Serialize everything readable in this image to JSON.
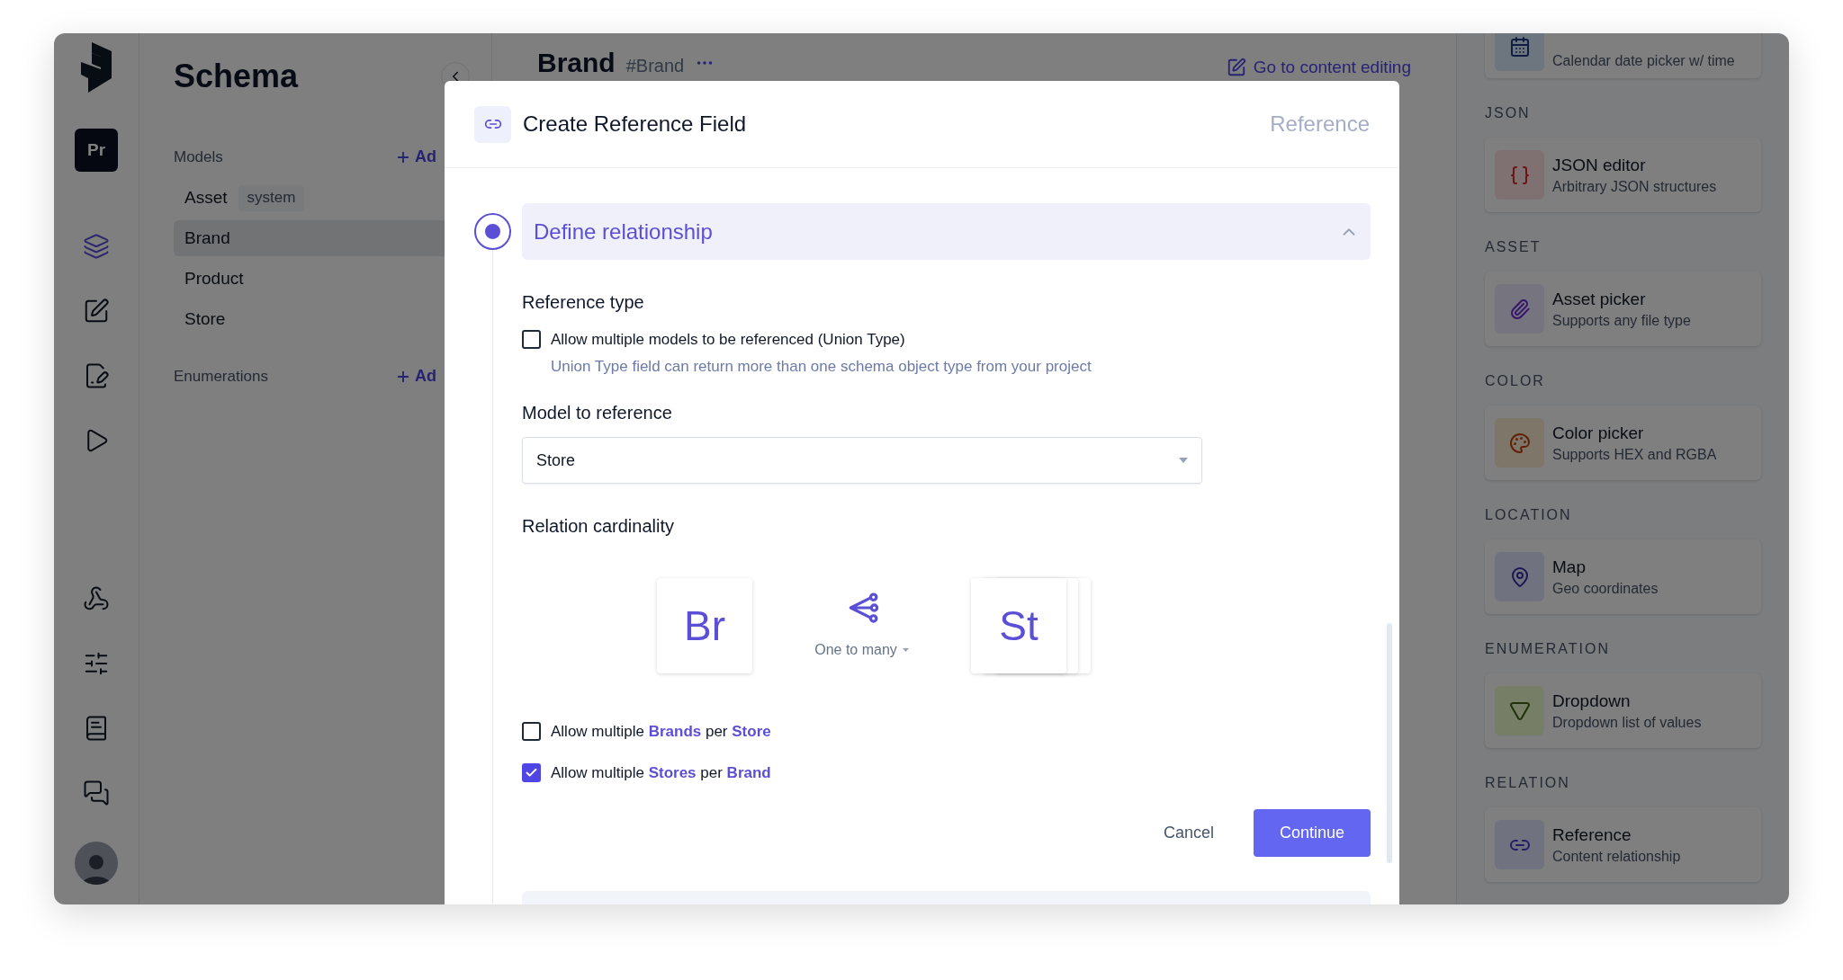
{
  "rail": {
    "project_badge": "Pr",
    "nav": [
      {
        "kind": "layers",
        "selected": true
      },
      {
        "kind": "edit",
        "selected": false
      },
      {
        "kind": "edit-clip",
        "selected": false
      },
      {
        "kind": "play",
        "selected": false
      },
      {
        "kind": "webhook",
        "selected": false
      },
      {
        "kind": "sliders",
        "selected": false
      },
      {
        "kind": "book",
        "selected": false
      },
      {
        "kind": "chat",
        "selected": false
      }
    ]
  },
  "schema": {
    "title": "Schema",
    "sections": [
      {
        "label": "Models",
        "add": "Ad",
        "items": [
          {
            "name": "Asset",
            "badge": "system",
            "selected": false
          },
          {
            "name": "Brand",
            "selected": true
          },
          {
            "name": "Product",
            "selected": false
          },
          {
            "name": "Store",
            "selected": false
          }
        ]
      },
      {
        "label": "Enumerations",
        "add": "Ad"
      }
    ]
  },
  "main": {
    "title": "Brand",
    "api_id": "#Brand",
    "link": "Go to content editing"
  },
  "fields_panel": {
    "top_item": {
      "kind": "calendar",
      "description": "Calendar date picker w/ time"
    },
    "groups": [
      {
        "label": "JSON",
        "items": [
          {
            "kind": "json",
            "title": "JSON editor",
            "description": "Arbitrary JSON structures"
          }
        ]
      },
      {
        "label": "ASSET",
        "items": [
          {
            "kind": "asset",
            "title": "Asset picker",
            "description": "Supports any file type"
          }
        ]
      },
      {
        "label": "COLOR",
        "items": [
          {
            "kind": "color",
            "title": "Color picker",
            "description": "Supports HEX and RGBA"
          }
        ]
      },
      {
        "label": "LOCATION",
        "items": [
          {
            "kind": "map",
            "title": "Map",
            "description": "Geo coordinates"
          }
        ]
      },
      {
        "label": "ENUMERATION",
        "items": [
          {
            "kind": "dropdown",
            "title": "Dropdown",
            "description": "Dropdown list of values"
          }
        ]
      },
      {
        "label": "RELATION",
        "items": [
          {
            "kind": "reference",
            "title": "Reference",
            "description": "Content relationship"
          }
        ]
      }
    ]
  },
  "modal": {
    "title": "Create Reference Field",
    "type_label": "Reference",
    "step": {
      "title": "Define relationship",
      "selected": true,
      "expanded": true
    },
    "reference_type": {
      "label": "Reference type",
      "option": {
        "label": "Allow multiple models to be referenced (Union Type)",
        "checked": false,
        "hint": "Union Type field can return more than one schema object type from your project"
      }
    },
    "model_to_reference": {
      "label": "Model to reference",
      "value": "Store"
    },
    "cardinality": {
      "label": "Relation cardinality",
      "source": "Br",
      "target": "St",
      "relation": "One to many",
      "options": [
        {
          "text": "Allow multiple **Brands** per **Store**",
          "checked": false
        },
        {
          "text": "Allow multiple **Stores** per **Brand**",
          "checked": true
        }
      ]
    },
    "actions": {
      "cancel": "Cancel",
      "continue": "Continue"
    }
  }
}
